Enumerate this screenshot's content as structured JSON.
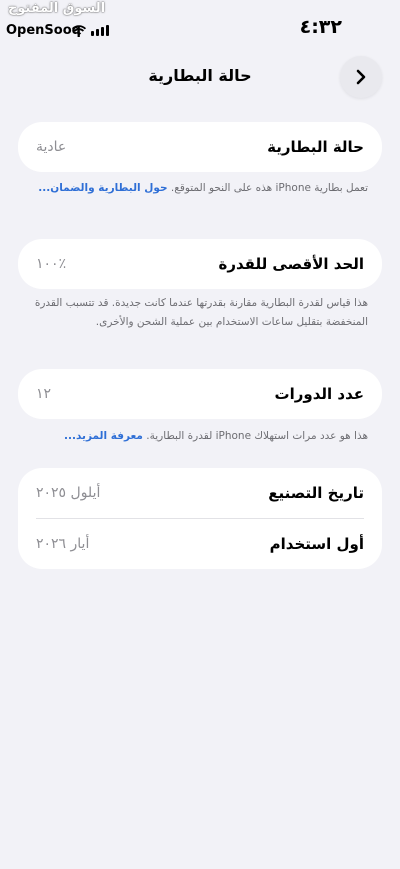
{
  "status": {
    "time": "٤:٣٢",
    "watermark_ar": "السوق المفتوح",
    "watermark_en": "OpenSooq"
  },
  "nav": {
    "title": "حالة البطارية"
  },
  "health": {
    "label": "حالة البطارية",
    "value": "عادية",
    "note": "تعمل بطارية iPhone هذه على النحو المتوقع.",
    "link": "حول البطارية والضمان..."
  },
  "capacity": {
    "label": "الحد الأقصى للقدرة",
    "value": "٪١٠٠",
    "note": "هذا قياس لقدرة البطارية مقارنة بقدرتها عندما كانت جديدة. قد تتسبب القدرة المنخفضة بتقليل ساعات الاستخدام بين عملية الشحن والأخرى."
  },
  "cycles": {
    "label": "عدد الدورات",
    "value": "١٢",
    "note": "هذا هو عدد مرات استهلاك iPhone لقدرة البطارية.",
    "link": "معرفة المزيد..."
  },
  "dates": {
    "manufacture_label": "تاريخ التصنيع",
    "manufacture_value": "أيلول ٢٠٢٥",
    "first_use_label": "أول استخدام",
    "first_use_value": "أيار ٢٠٢٦"
  }
}
